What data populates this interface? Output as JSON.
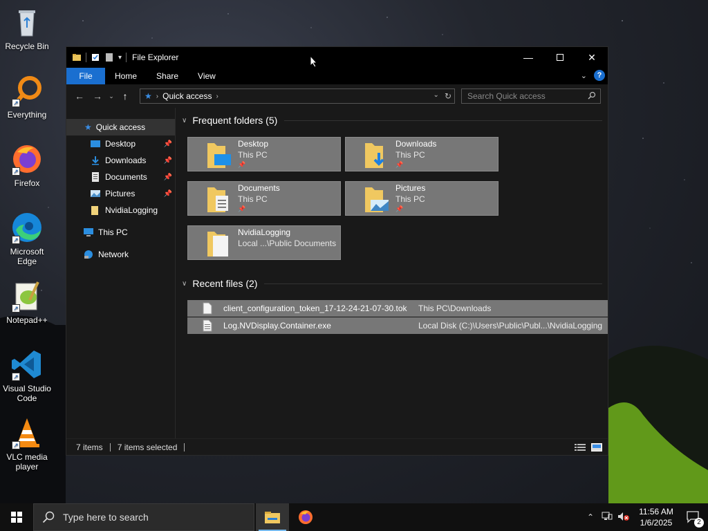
{
  "desktop": {
    "icons": [
      {
        "label": "Recycle Bin"
      },
      {
        "label": "Everything"
      },
      {
        "label": "Firefox"
      },
      {
        "label": "Microsoft Edge"
      },
      {
        "label": "Notepad++"
      },
      {
        "label": "Visual Studio Code"
      },
      {
        "label": "VLC media player"
      }
    ]
  },
  "window": {
    "title": "File Explorer",
    "ribbon": {
      "tabs": [
        "File",
        "Home",
        "Share",
        "View"
      ]
    },
    "address": {
      "path": "Quick access",
      "search_placeholder": "Search Quick access"
    },
    "sidebar": {
      "items": [
        {
          "label": "Quick access"
        },
        {
          "label": "Desktop"
        },
        {
          "label": "Downloads"
        },
        {
          "label": "Documents"
        },
        {
          "label": "Pictures"
        },
        {
          "label": "NvidiaLogging"
        },
        {
          "label": "This PC"
        },
        {
          "label": "Network"
        }
      ]
    },
    "frequent": {
      "header": "Frequent folders (5)",
      "folders": [
        {
          "name": "Desktop",
          "location": "This PC"
        },
        {
          "name": "Downloads",
          "location": "This PC"
        },
        {
          "name": "Documents",
          "location": "This PC"
        },
        {
          "name": "Pictures",
          "location": "This PC"
        },
        {
          "name": "NvidiaLogging",
          "location": "Local ...\\Public Documents"
        }
      ]
    },
    "recent": {
      "header": "Recent files (2)",
      "files": [
        {
          "name": "client_configuration_token_17-12-24-21-07-30.tok",
          "location": "This PC\\Downloads"
        },
        {
          "name": "Log.NVDisplay.Container.exe",
          "location": "Local Disk (C:)\\Users\\Public\\Publ...\\NvidiaLogging"
        }
      ]
    },
    "status": {
      "items": "7 items",
      "selected": "7 items selected"
    }
  },
  "taskbar": {
    "search_placeholder": "Type here to search",
    "time": "11:56 AM",
    "date": "1/6/2025",
    "notification_count": "2"
  },
  "colors": {
    "accent": "#1a6fd0",
    "tile": "#777777",
    "window_bg": "#191919"
  }
}
